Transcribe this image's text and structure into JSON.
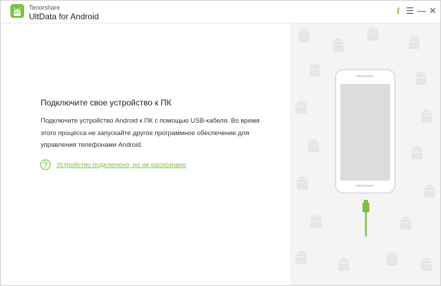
{
  "app": {
    "brand": "Tenorshare",
    "product": "UltData for Android"
  },
  "titlebar": {
    "facebook_glyph": "f",
    "menu_glyph": "☰",
    "minimize_glyph": "—",
    "close_glyph": "✕"
  },
  "main": {
    "heading": "Подключите свое устройство к ПК",
    "description": "Подключите устройство Android к ПК с помощью USB-кабеля. Во время этого процесса не запускайте другое программное обеспечение для управления телефонами Android.",
    "help_link": "Устройство подключено, но не распознано"
  },
  "colors": {
    "accent": "#7cc242",
    "pattern_bg": "#f4f4f4",
    "phone_screen": "#dcdcdc"
  },
  "icons": {
    "logo": "ultdata-logo-icon",
    "help": "question-circle-icon",
    "facebook": "facebook-icon",
    "menu": "menu-icon",
    "minimize": "minimize-icon",
    "close": "close-icon",
    "phone": "smartphone-illustration",
    "usb": "usb-cable-icon"
  }
}
